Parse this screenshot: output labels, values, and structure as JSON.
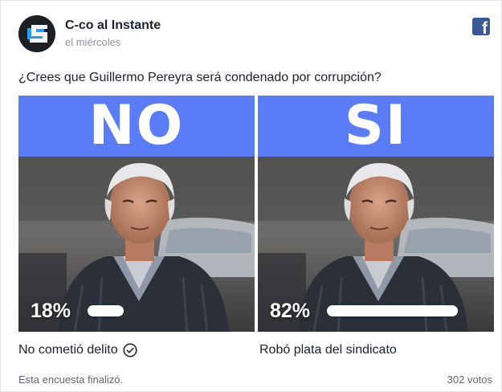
{
  "post": {
    "page_name": "C-co al Instante",
    "time": "el miércoles",
    "question": "¿Crees que Guillermo Pereyra será condenado por corrupción?"
  },
  "icons": {
    "logo": "page-logo-icon",
    "facebook": "facebook-icon",
    "check": "checkmark-circle-icon"
  },
  "colors": {
    "banner": "#5b7cf7",
    "facebook": "#3b5998"
  },
  "poll": {
    "options": [
      {
        "banner_text": "NO",
        "percent_label": "18%",
        "percent": 18,
        "label": "No cometió delito",
        "selected": true
      },
      {
        "banner_text": "SI",
        "percent_label": "82%",
        "percent": 82,
        "label": "Robó plata del sindicato",
        "selected": false
      }
    ],
    "status": "Esta encuesta finalizó.",
    "votes": "302 votos"
  }
}
